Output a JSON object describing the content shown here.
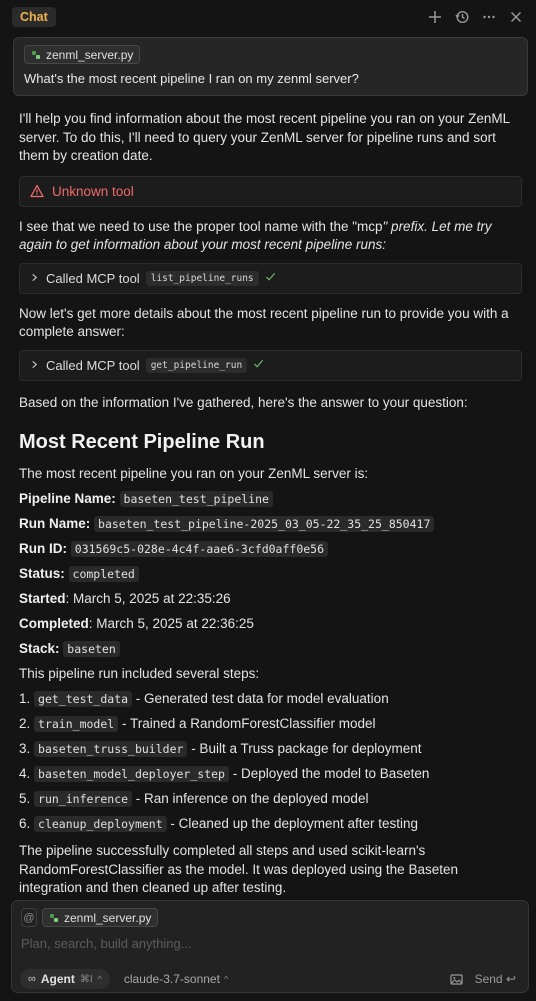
{
  "header": {
    "tab_label": "Chat",
    "icons": [
      "plus-icon",
      "history-icon",
      "more-icon",
      "close-icon"
    ]
  },
  "user_message": {
    "file_chip": "zenml_server.py",
    "text": "What's the most recent pipeline I ran on my zenml server?"
  },
  "assistant": {
    "intro": "I'll help you find information about the most recent pipeline you ran on your ZenML server. To do this, I'll need to query your ZenML server for pipeline runs and sort them by creation date.",
    "warning": "Unknown tool",
    "note_plain": "I see that we need to use the proper tool name with the \"mcp",
    "note_italic": "\" prefix. Let me try again to get information about your most recent pipeline runs:",
    "tool_call_1": {
      "label": "Called MCP tool",
      "name": "list_pipeline_runs"
    },
    "more_details": "Now let's get more details about the most recent pipeline run to provide you with a complete answer:",
    "tool_call_2": {
      "label": "Called MCP tool",
      "name": "get_pipeline_run"
    },
    "based_on": "Based on the information I've gathered, here's the answer to your question:",
    "heading": "Most Recent Pipeline Run",
    "summary_intro": "The most recent pipeline you ran on your ZenML server is:",
    "fields": {
      "pipeline_name_label": "Pipeline Name:",
      "pipeline_name": "baseten_test_pipeline",
      "run_name_label": "Run Name:",
      "run_name": "baseten_test_pipeline-2025_03_05-22_35_25_850417",
      "run_id_label": "Run ID:",
      "run_id": "031569c5-028e-4c4f-aae6-3cfd0aff0e56",
      "status_label": "Status:",
      "status": "completed",
      "started_label": "Started",
      "started": ": March 5, 2025 at 22:35:26",
      "completed_label": "Completed",
      "completed": ": March 5, 2025 at 22:36:25",
      "stack_label": "Stack:",
      "stack": "baseten"
    },
    "steps_intro": "This pipeline run included several steps:",
    "steps": [
      {
        "num": "1.",
        "code": "get_test_data",
        "desc": " - Generated test data for model evaluation"
      },
      {
        "num": "2.",
        "code": "train_model",
        "desc": " - Trained a RandomForestClassifier model"
      },
      {
        "num": "3.",
        "code": "baseten_truss_builder",
        "desc": " - Built a Truss package for deployment"
      },
      {
        "num": "4.",
        "code": "baseten_model_deployer_step",
        "desc": " - Deployed the model to Baseten"
      },
      {
        "num": "5.",
        "code": "run_inference",
        "desc": " - Ran inference on the deployed model"
      },
      {
        "num": "6.",
        "code": "cleanup_deployment",
        "desc": " - Cleaned up the deployment after testing"
      }
    ],
    "conclusion": "The pipeline successfully completed all steps and used scikit-learn's RandomForestClassifier as the model. It was deployed using the Baseten integration and then cleaned up after testing."
  },
  "composer": {
    "at_symbol": "@",
    "file_chip": "zenml_server.py",
    "placeholder": "Plan, search, build anything...",
    "agent_symbol": "∞",
    "agent_label": "Agent",
    "agent_shortcut": "⌘I",
    "caret": "^",
    "model": "claude-3.7-sonnet",
    "send_label": "Send",
    "send_symbol": "↩"
  },
  "colors": {
    "background": "#141414",
    "accent_tab": "#f0b34a",
    "warning": "#f06b6b",
    "success": "#6fb36f"
  }
}
